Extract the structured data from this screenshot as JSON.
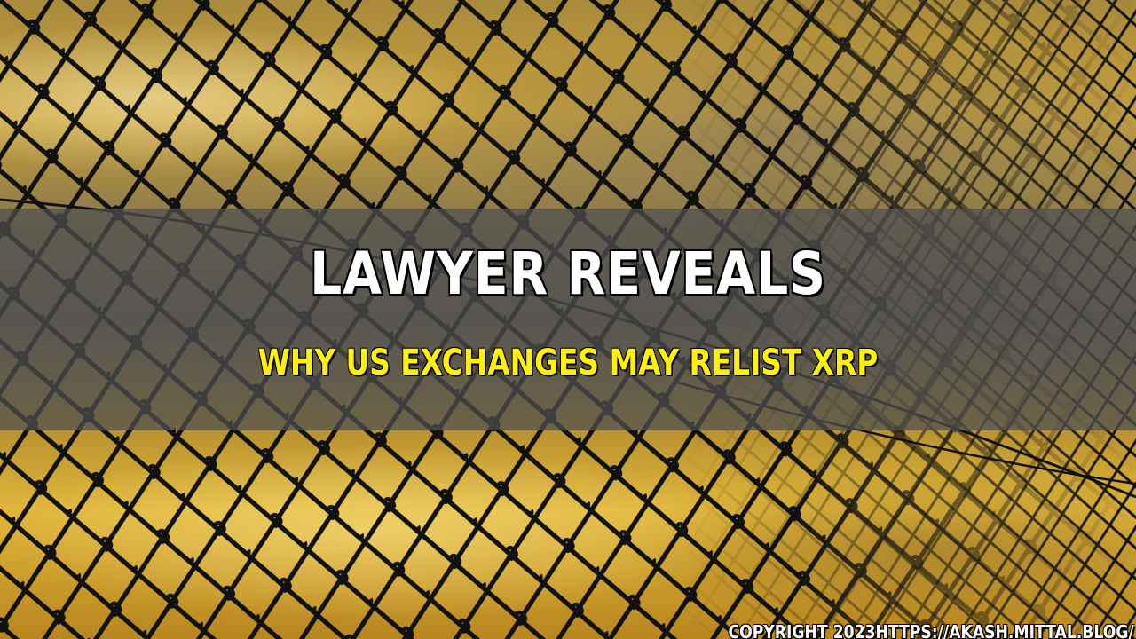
{
  "headline": "LAWYER REVEALS",
  "subheadline": "WHY US EXCHANGES MAY RELIST XRP",
  "copyright": "COPYRIGHT 2023HTTPS://AKASH.MITTAL.BLOG/",
  "colors": {
    "band": "#505050",
    "headline": "#ffffff",
    "subheadline": "#fff200",
    "fence_wire": "#111111",
    "sky_gold": "#e0b63a"
  }
}
